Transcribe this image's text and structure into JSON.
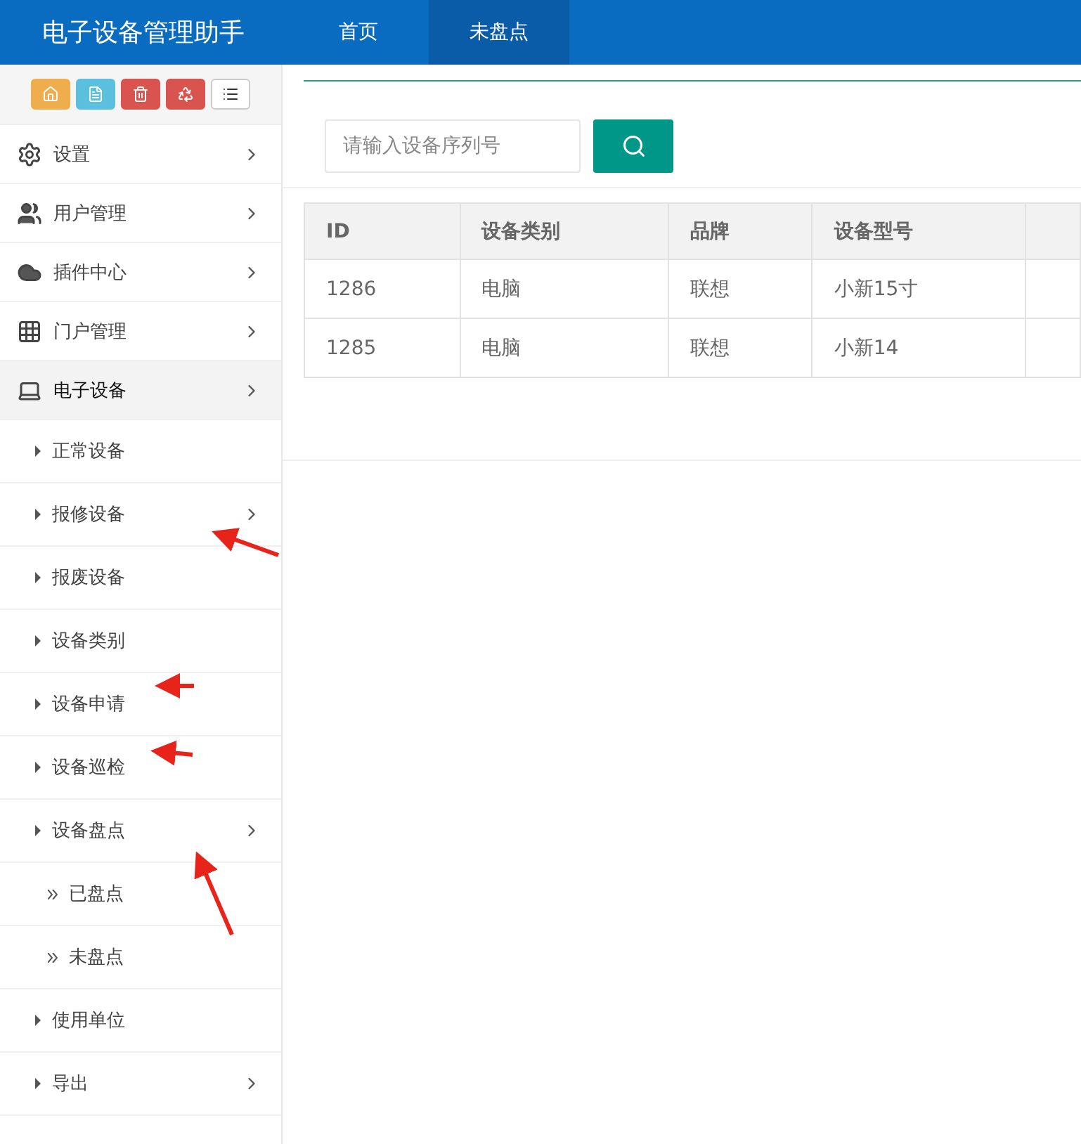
{
  "header": {
    "title": "电子设备管理助手",
    "tabs": [
      {
        "label": "首页",
        "selected": false
      },
      {
        "label": "未盘点",
        "selected": true
      }
    ]
  },
  "toolbar": [
    {
      "kind": "home",
      "color": "#f0ad4e"
    },
    {
      "kind": "file",
      "color": "#5bc0de"
    },
    {
      "kind": "trash",
      "color": "#d9534f"
    },
    {
      "kind": "recycle",
      "color": "#d9534f"
    },
    {
      "kind": "list",
      "color": "#ffffff"
    }
  ],
  "sidebar": {
    "items": [
      {
        "label": "设置",
        "kind": "gears",
        "expandable": true,
        "expanded": false
      },
      {
        "label": "用户管理",
        "kind": "users",
        "expandable": true,
        "expanded": false
      },
      {
        "label": "插件中心",
        "kind": "cloud",
        "expandable": true,
        "expanded": false
      },
      {
        "label": "门户管理",
        "kind": "grid",
        "expandable": true,
        "expanded": false
      },
      {
        "label": "电子设备",
        "kind": "laptop",
        "expandable": true,
        "expanded": true,
        "children": [
          {
            "label": "正常设备",
            "expandable": false
          },
          {
            "label": "报修设备",
            "expandable": true
          },
          {
            "label": "报废设备",
            "expandable": false
          },
          {
            "label": "设备类别",
            "expandable": false
          },
          {
            "label": "设备申请",
            "expandable": false
          },
          {
            "label": "设备巡检",
            "expandable": false
          },
          {
            "label": "设备盘点",
            "expandable": true,
            "children": [
              {
                "label": "已盘点",
                "expandable": false
              },
              {
                "label": "未盘点",
                "expandable": false
              }
            ]
          },
          {
            "label": "使用单位",
            "expandable": false
          },
          {
            "label": "导出",
            "expandable": true
          }
        ]
      }
    ]
  },
  "search": {
    "placeholder": "请输入设备序列号"
  },
  "table": {
    "columns": [
      "ID",
      "设备类别",
      "品牌",
      "设备型号"
    ],
    "rows": [
      [
        "1286",
        "电脑",
        "联想",
        "小新15寸"
      ],
      [
        "1285",
        "电脑",
        "联想",
        "小新14"
      ]
    ]
  }
}
